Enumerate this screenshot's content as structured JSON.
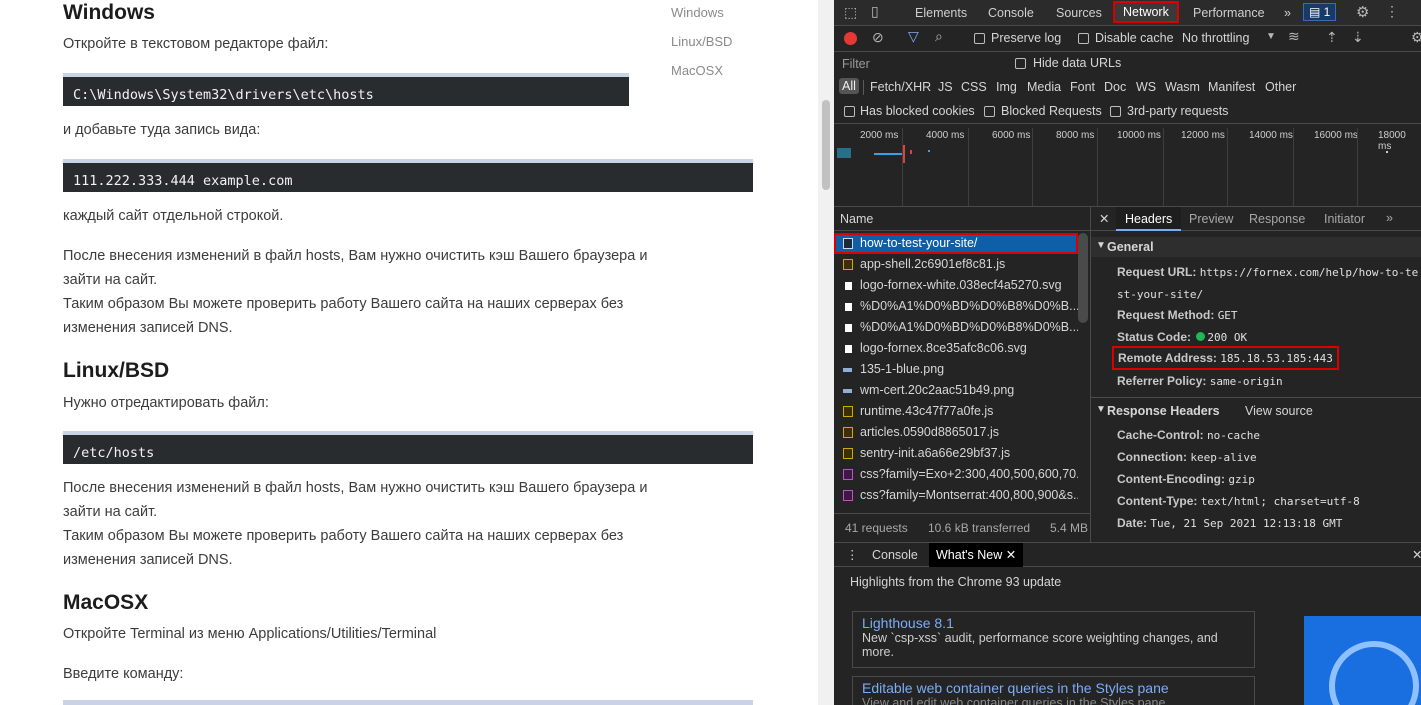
{
  "page": {
    "sections": [
      {
        "heading": "Windows",
        "text1": "Откройте в текстовом редакторе файл:",
        "code1": "C:\\Windows\\System32\\drivers\\etc\\hosts",
        "text2": "и добавьте туда запись вида:",
        "code2": "111.222.333.444 example.com",
        "text3": "каждый сайт отдельной строкой.",
        "p1": "После внесения изменений в файл hosts, Вам нужно очистить кэш Вашего браузера и",
        "p2": "зайти на сайт.",
        "p3": "Таким образом Вы можете проверить работу Вашего сайта на наших серверах без",
        "p4": "изменения записей DNS."
      },
      {
        "heading": "Linux/BSD",
        "text1": "Нужно отредактировать файл:",
        "code1": "/etc/hosts",
        "p1": "После внесения изменений в файл hosts, Вам нужно очистить кэш Вашего браузера и",
        "p2": "зайти на сайт.",
        "p3": "Таким образом Вы можете проверить работу Вашего сайта на наших серверах без",
        "p4": "изменения записей DNS."
      },
      {
        "heading": "MacOSX",
        "text1": "Откройте Terminal из меню Applications/Utilities/Terminal",
        "text2": "Введите команду:"
      }
    ],
    "toc": [
      "Windows",
      "Linux/BSD",
      "MacOSX"
    ]
  },
  "devtools": {
    "tabs": [
      "Elements",
      "Console",
      "Sources",
      "Network",
      "Performance"
    ],
    "active_tab": "Network",
    "more_tabs": "»",
    "badge_count": "1",
    "toolbar": {
      "preserve_log": "Preserve log",
      "disable_cache": "Disable cache",
      "throttling": "No throttling"
    },
    "filter": {
      "placeholder": "Filter",
      "hide_data_urls": "Hide data URLs"
    },
    "types": [
      "All",
      "Fetch/XHR",
      "JS",
      "CSS",
      "Img",
      "Media",
      "Font",
      "Doc",
      "WS",
      "Wasm",
      "Manifest",
      "Other"
    ],
    "blocked": {
      "blocked_cookies": "Has blocked cookies",
      "blocked_requests": "Blocked Requests",
      "third_party": "3rd-party requests"
    },
    "timeline_ticks": [
      "2000 ms",
      "4000 ms",
      "6000 ms",
      "8000 ms",
      "10000 ms",
      "12000 ms",
      "14000 ms",
      "16000 ms",
      "18000 ms"
    ],
    "list_header": "Name",
    "requests": [
      {
        "name": "how-to-test-your-site/",
        "type": "doc"
      },
      {
        "name": "app-shell.2c6901ef8c81.js",
        "type": "js"
      },
      {
        "name": "logo-fornex-white.038ecf4a5270.svg",
        "type": "svg"
      },
      {
        "name": "%D0%A1%D0%BD%D0%B8%D0%B...",
        "type": "svg"
      },
      {
        "name": "%D0%A1%D0%BD%D0%B8%D0%B...",
        "type": "svg"
      },
      {
        "name": "logo-fornex.8ce35afc8c06.svg",
        "type": "svg"
      },
      {
        "name": "135-1-blue.png",
        "type": "png"
      },
      {
        "name": "wm-cert.20c2aac51b49.png",
        "type": "png"
      },
      {
        "name": "runtime.43c47f77a0fe.js",
        "type": "js"
      },
      {
        "name": "articles.0590d8865017.js",
        "type": "js"
      },
      {
        "name": "sentry-init.a6a66e29bf37.js",
        "type": "js"
      },
      {
        "name": "css?family=Exo+2:300,400,500,600,70...",
        "type": "css"
      },
      {
        "name": "css?family=Montserrat:400,800,900&s...",
        "type": "css"
      }
    ],
    "status_bar": {
      "requests": "41 requests",
      "transferred": "10.6 kB transferred",
      "resources": "5.4 MB"
    },
    "detail_tabs": [
      "Headers",
      "Preview",
      "Response",
      "Initiator"
    ],
    "general": {
      "title": "General",
      "request_url_label": "Request URL:",
      "request_url_1": "https://fornex.com/help/how-to-te",
      "request_url_2": "st-your-site/",
      "method_label": "Request Method:",
      "method": "GET",
      "status_label": "Status Code:",
      "status": "200 OK",
      "remote_label": "Remote Address:",
      "remote": "185.18.53.185:443",
      "referrer_label": "Referrer Policy:",
      "referrer": "same-origin"
    },
    "response_headers": {
      "title": "Response Headers",
      "view_source": "View source",
      "items": [
        {
          "k": "Cache-Control:",
          "v": "no-cache"
        },
        {
          "k": "Connection:",
          "v": "keep-alive"
        },
        {
          "k": "Content-Encoding:",
          "v": "gzip"
        },
        {
          "k": "Content-Type:",
          "v": "text/html; charset=utf-8"
        },
        {
          "k": "Date:",
          "v": "Tue, 21 Sep 2021 12:13:18 GMT"
        }
      ]
    },
    "drawer": {
      "tabs": [
        "Console",
        "What's New"
      ],
      "headline": "Highlights from the Chrome 93 update",
      "cards": [
        {
          "title": "Lighthouse 8.1",
          "desc1": "New `csp-xss` audit, performance score weighting changes, and",
          "desc2": "more."
        },
        {
          "title": "Editable web container queries in the Styles pane",
          "desc1": "View and edit web container queries in the Styles pane",
          "desc2": ""
        }
      ]
    },
    "colors": {
      "highlight": "#d90000",
      "selected_row": "#0f5ea8",
      "link": "#7cacf8",
      "status_ok": "#1db954"
    }
  }
}
